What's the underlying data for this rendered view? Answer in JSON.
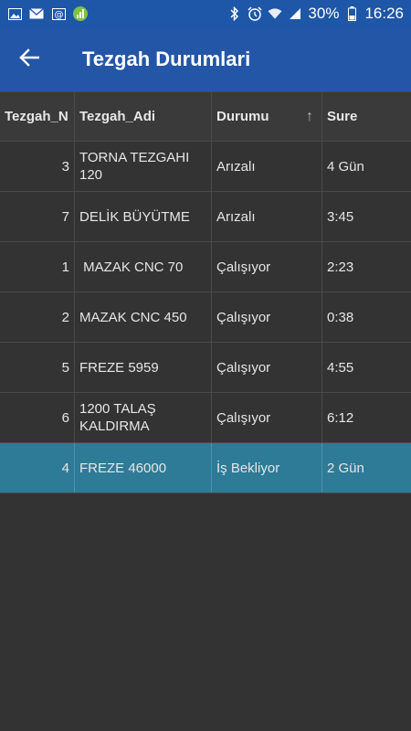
{
  "status_bar": {
    "battery": "30%",
    "time": "16:26",
    "left_icons": [
      "image-icon",
      "mail-icon",
      "email-at-icon",
      "signal-app-icon"
    ],
    "right_icons": [
      "bluetooth-icon",
      "alarm-icon",
      "wifi-icon",
      "signal-icon",
      "battery-icon"
    ]
  },
  "app_bar": {
    "title": "Tezgah Durumlari",
    "back_icon": "arrow-left-icon"
  },
  "table": {
    "columns": [
      "Tezgah_N",
      "Tezgah_Adi",
      "Durumu",
      "Sure"
    ],
    "sort_indicator": "↑",
    "rows": [
      {
        "no": "3",
        "name": "TORNA TEZGAHI 120",
        "status": "Arızalı",
        "time": "4 Gün",
        "selected": false
      },
      {
        "no": "7",
        "name": "DELİK BÜYÜTME",
        "status": "Arızalı",
        "time": "3:45",
        "selected": false
      },
      {
        "no": "1",
        "name": " MAZAK CNC 70",
        "status": "Çalışıyor",
        "time": "2:23",
        "selected": false
      },
      {
        "no": "2",
        "name": "MAZAK CNC 450",
        "status": "Çalışıyor",
        "time": "0:38",
        "selected": false
      },
      {
        "no": "5",
        "name": "FREZE 5959",
        "status": "Çalışıyor",
        "time": "4:55",
        "selected": false
      },
      {
        "no": "6",
        "name": "1200 TALAŞ KALDIRMA",
        "status": "Çalışıyor",
        "time": "6:12",
        "selected": false
      },
      {
        "no": "4",
        "name": "FREZE 46000",
        "status": "İş Bekliyor",
        "time": "2 Gün",
        "selected": true
      }
    ]
  },
  "colors": {
    "app_bar": "#2456a7",
    "status_bar": "#1e56a8",
    "background": "#333333",
    "selected_row": "#2e7b97"
  }
}
